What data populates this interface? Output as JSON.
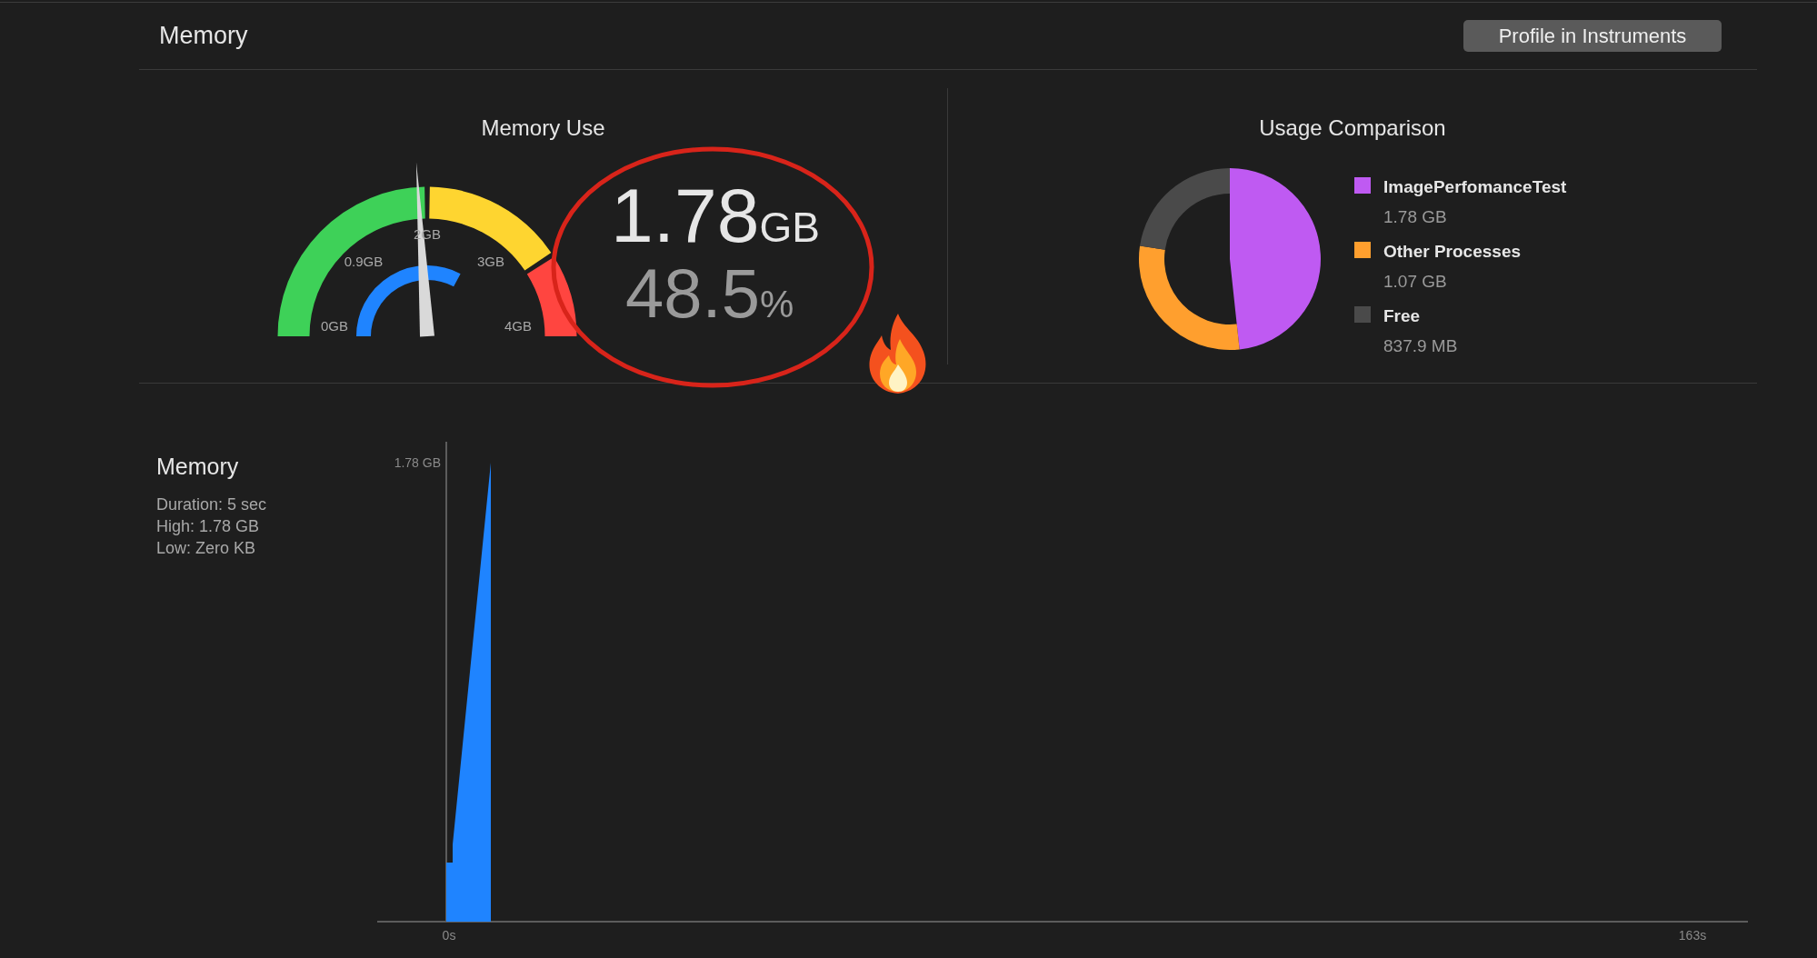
{
  "header": {
    "title": "Memory",
    "button": "Profile in Instruments"
  },
  "memory_use": {
    "title": "Memory Use",
    "gauge": {
      "level": 0.48,
      "labels": [
        "0GB",
        "0.9GB",
        "2GB",
        "3GB",
        "4GB"
      ]
    },
    "value": "1.78",
    "value_unit": "GB",
    "percent": "48.5",
    "percent_unit": "%"
  },
  "usage_comparison": {
    "title": "Usage Comparison",
    "chart_data": {
      "type": "pie",
      "series": [
        {
          "values": [
            48.3,
            29.0,
            22.7
          ]
        }
      ]
    },
    "legend": [
      {
        "name": "ImagePerfomanceTest",
        "value": "1.78 GB",
        "color": "#bf5af2"
      },
      {
        "name": "Other Processes",
        "value": "1.07 GB",
        "color": "#ff9f2e"
      },
      {
        "name": "Free",
        "value": "837.9 MB",
        "color": "#4a4a4a"
      }
    ]
  },
  "memory_chart": {
    "title": "Memory",
    "stats": [
      "Duration: 5 sec",
      "High: 1.78 GB",
      "Low: Zero KB"
    ],
    "peak_label": "1.78 GB",
    "time_labels": [
      "0s",
      "163s"
    ]
  }
}
